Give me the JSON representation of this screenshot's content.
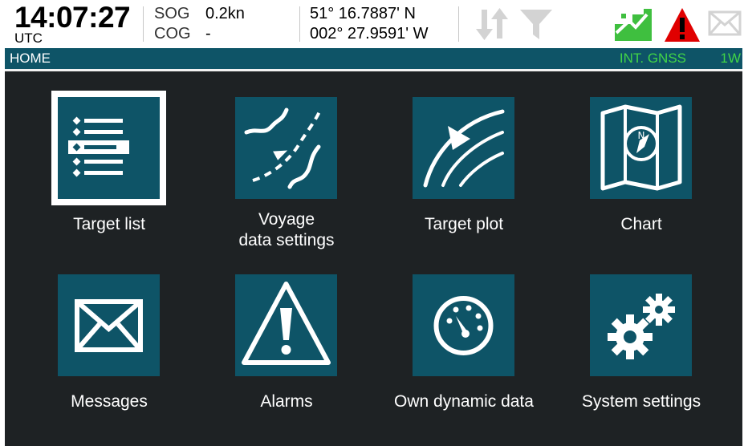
{
  "header": {
    "time": "14:07:27",
    "timezone": "UTC",
    "sog_label": "SOG",
    "sog_value": "0.2kn",
    "cog_label": "COG",
    "cog_value": "-",
    "latitude": "51° 16.7887' N",
    "longitude": "002° 27.9591' W",
    "icons": [
      "transfer-arrows-icon",
      "filter-icon",
      "gnss-antenna-icon",
      "alarm-warning-icon",
      "message-envelope-icon"
    ]
  },
  "statusbar": {
    "title": "HOME",
    "gnss_source": "INT. GNSS",
    "power": "1W"
  },
  "tiles": [
    {
      "label": "Target list",
      "icon": "target-list-icon",
      "selected": true
    },
    {
      "label_line1": "Voyage",
      "label_line2": "data settings",
      "icon": "voyage-data-icon"
    },
    {
      "label": "Target plot",
      "icon": "target-plot-icon"
    },
    {
      "label": "Chart",
      "icon": "chart-map-icon"
    },
    {
      "label": "Messages",
      "icon": "envelope-icon"
    },
    {
      "label": "Alarms",
      "icon": "warning-icon"
    },
    {
      "label": "Own dynamic data",
      "icon": "gauge-icon"
    },
    {
      "label": "System settings",
      "icon": "gears-icon"
    }
  ],
  "colors": {
    "tile_blue": "#0e5467",
    "background": "#1e2224",
    "gnss_green": "#41d447",
    "alarm_red": "#e00000",
    "antenna_green": "#3fbf3f"
  }
}
